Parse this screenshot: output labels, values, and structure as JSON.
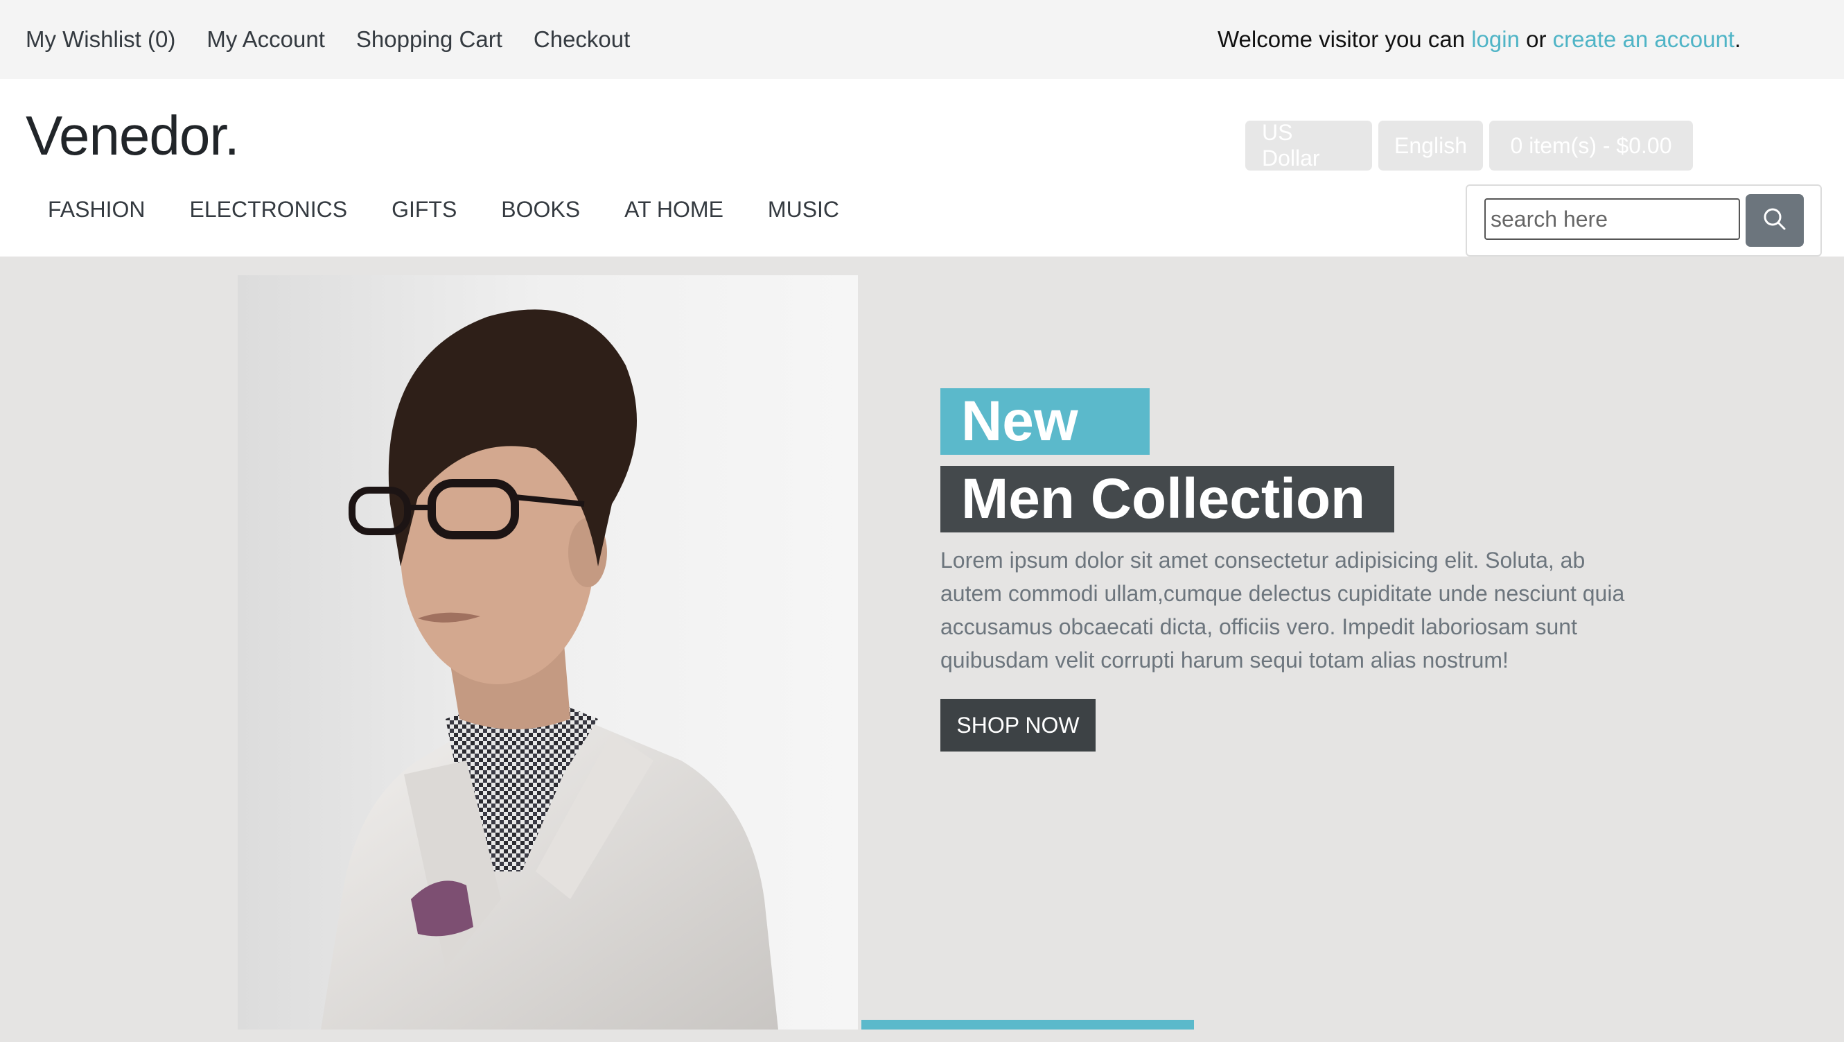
{
  "topbar": {
    "links": [
      "My Wishlist (0)",
      "My Account",
      "Shopping Cart",
      "Checkout"
    ],
    "welcome_prefix": "Welcome visitor you can ",
    "login_label": "login",
    "or_text": " or ",
    "create_account_label": "create an account",
    "welcome_suffix": "."
  },
  "header": {
    "logo": "Venedor.",
    "currency_label": "US Dollar",
    "language_label": "English",
    "cart_label": "0 item(s) - $0.00"
  },
  "nav": {
    "items": [
      "FASHION",
      "ELECTRONICS",
      "GIFTS",
      "BOOKS",
      "AT HOME",
      "MUSIC"
    ]
  },
  "search": {
    "placeholder": "search here",
    "icon": "search-icon"
  },
  "hero": {
    "tag_new": "New",
    "tag_collection": "Men Collection",
    "description": "Lorem ipsum dolor sit amet consectetur adipisicing elit. Soluta, ab autem commodi ullam,cumque delectus cupiditate unde nesciunt quia accusamus obcaecati dicta, officiis vero. Impedit laboriosam sunt quibusdam velit corrupti harum sequi totam alias nostrum!",
    "shop_now_label": "SHOP NOW"
  },
  "colors": {
    "accent": "#5bb9cb",
    "dark": "#44494c",
    "hero_bg": "#e5e4e3",
    "topbar_bg": "#f4f4f4"
  }
}
